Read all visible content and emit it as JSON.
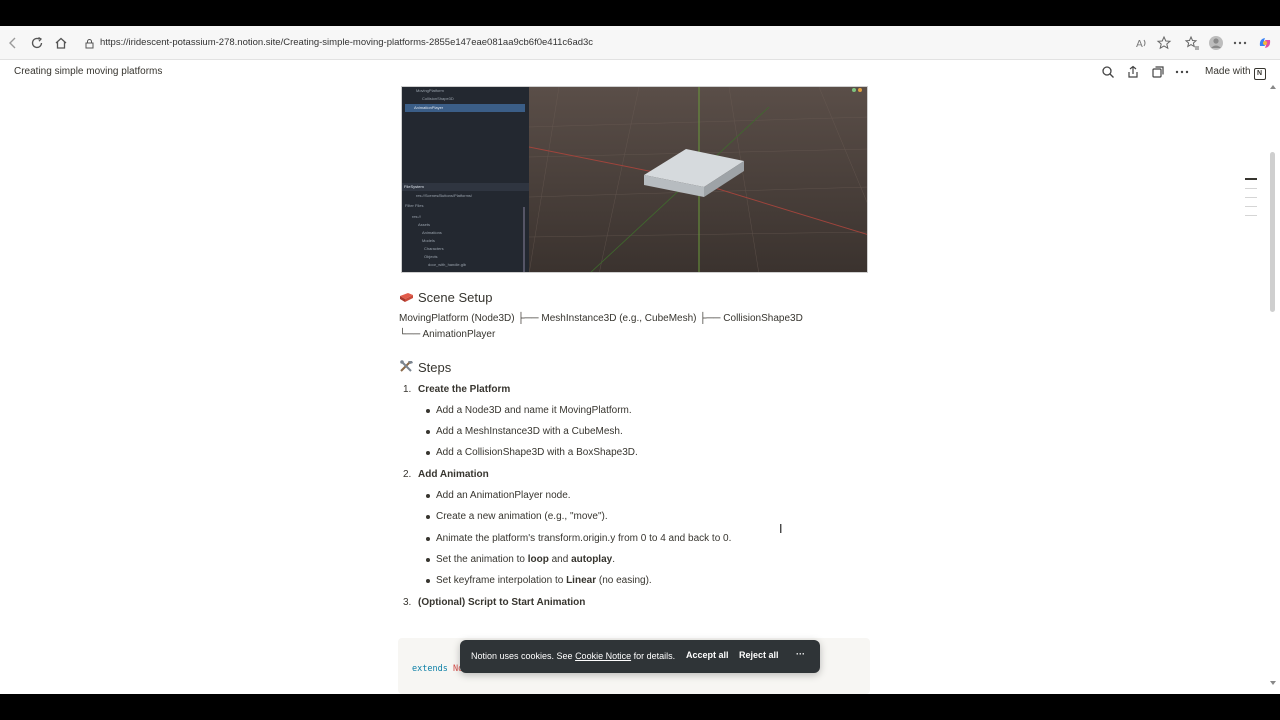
{
  "browser": {
    "url": "https://iridescent-potassium-278.notion.site/Creating-simple-moving-platforms-2855e147eae081aa9cb6f0e411c6ad3c",
    "icons": [
      "back-icon",
      "refresh-icon",
      "home-icon",
      "lock-icon",
      "read-aloud-icon",
      "favorite-star-icon",
      "favorites-icon",
      "profile-icon",
      "more-icon",
      "copilot-icon"
    ]
  },
  "notion_header": {
    "title": "Creating simple moving platforms",
    "made_with_label": "Made with",
    "icons": [
      "search-icon",
      "share-icon",
      "duplicate-icon",
      "more-icon"
    ]
  },
  "editor_panel": {
    "rows": [
      "MovingPlatform",
      "CollisionShape3D",
      "AnimationPlayer"
    ],
    "filesystem_header": "FileSystem",
    "path": "res://Scenes/Buttons/Platforms/",
    "filter": "Filter Files",
    "tree": [
      "res://",
      "Assets",
      "Animations",
      "Models",
      "Characters",
      "Objects",
      "door_with_handle.glb"
    ]
  },
  "scene_setup": {
    "heading": "Scene Setup",
    "line1": "MovingPlatform (Node3D)   ├── MeshInstance3D (e.g., CubeMesh)   ├── CollisionShape3D",
    "line2": "└── AnimationPlayer"
  },
  "steps": {
    "heading": "Steps",
    "items": [
      {
        "num": "1.",
        "title": "Create the Platform",
        "bullets": [
          "Add a Node3D and name it MovingPlatform.",
          "Add a MeshInstance3D with a CubeMesh.",
          "Add a CollisionShape3D with a BoxShape3D."
        ]
      },
      {
        "num": "2.",
        "title": "Add Animation",
        "bullets": [
          "Add an AnimationPlayer node.",
          "Create a new animation (e.g., \"move\").",
          "Animate the platform's transform.origin.y from 0 to 4 and back to 0."
        ],
        "b4_pre": "Set the animation to ",
        "b4_bold1": "loop",
        "b4_mid": " and ",
        "b4_bold2": "autoplay",
        "b4_post": ".",
        "b5_pre": "Set keyframe interpolation to ",
        "b5_bold": "Linear",
        "b5_post": " (no easing)."
      },
      {
        "num": "3.",
        "title": "(Optional) Script to Start Animation"
      }
    ]
  },
  "code": {
    "keyword": "extends",
    "type": "No"
  },
  "cookie_banner": {
    "msg_pre": "Notion uses cookies. See ",
    "link": "Cookie Notice",
    "msg_post": " for details.",
    "accept": "Accept all",
    "reject": "Reject all",
    "more": "···"
  }
}
